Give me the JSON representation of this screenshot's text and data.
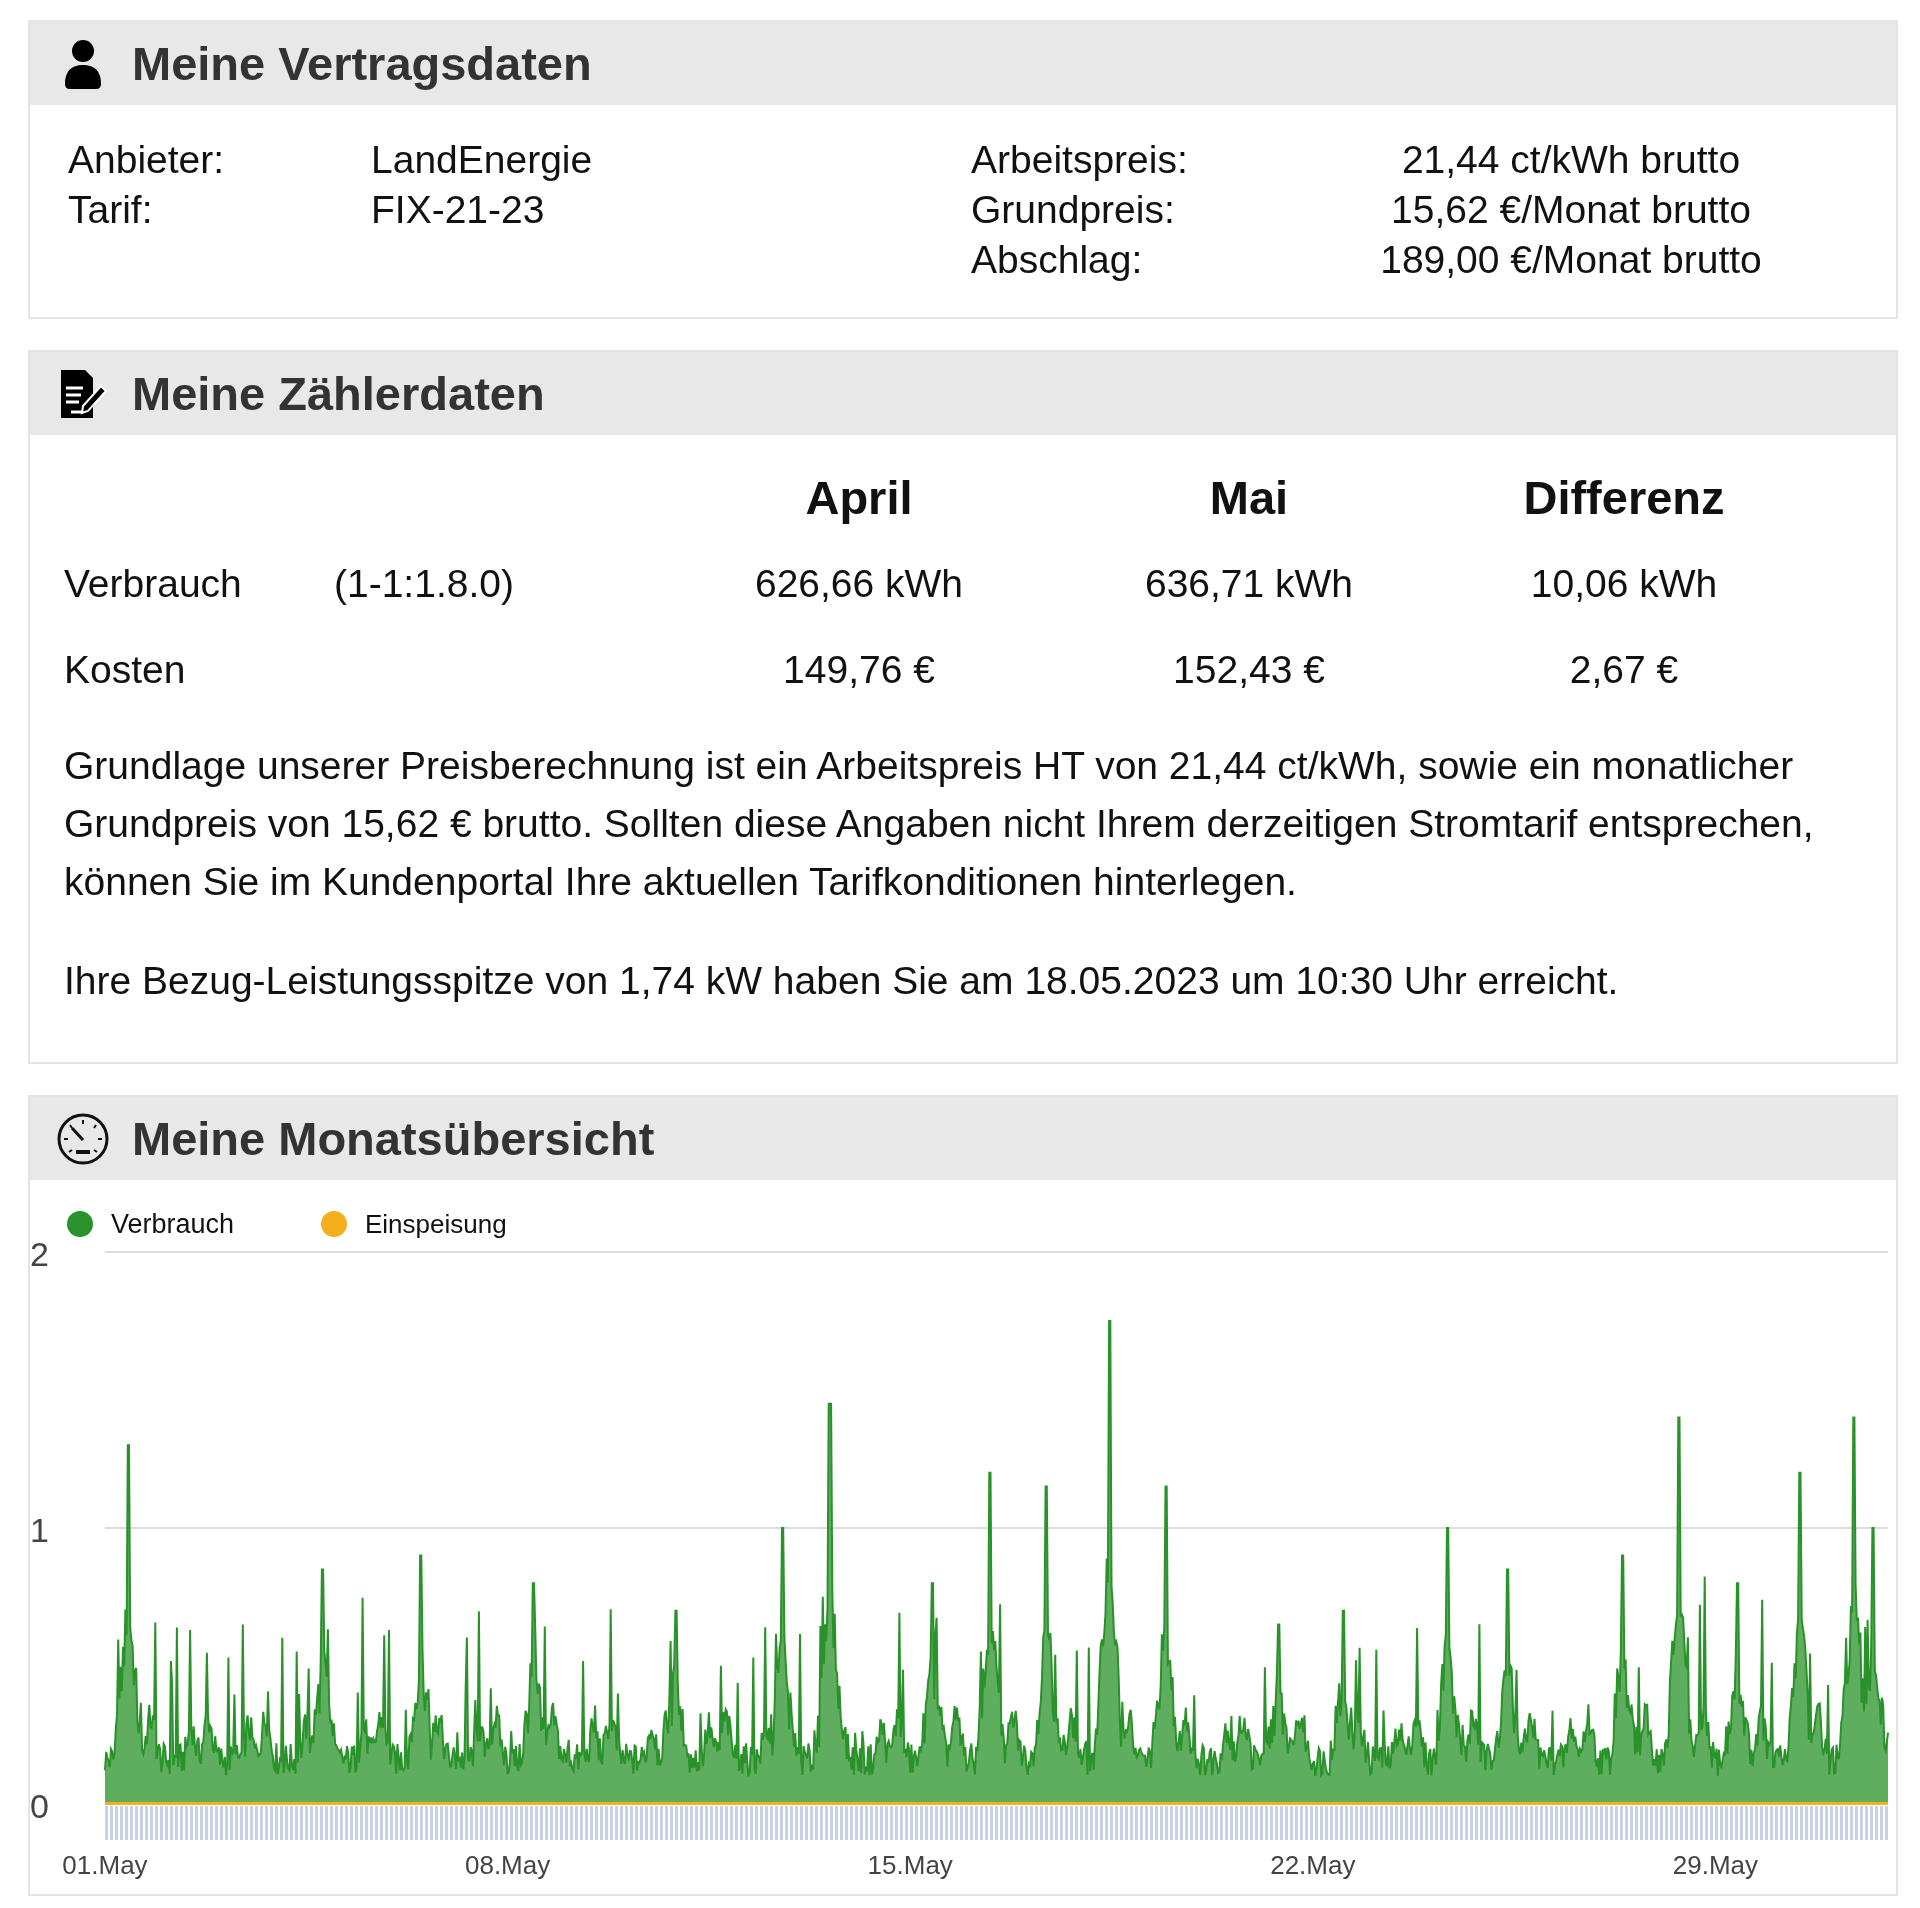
{
  "contract": {
    "title": "Meine Vertragsdaten",
    "left": [
      {
        "label": "Anbieter:",
        "value": "LandEnergie"
      },
      {
        "label": "Tarif:",
        "value": "FIX-21-23"
      }
    ],
    "right": [
      {
        "label": "Arbeitspreis:",
        "value": "21,44 ct/kWh brutto"
      },
      {
        "label": "Grundpreis:",
        "value": "15,62 €/Monat brutto"
      },
      {
        "label": "Abschlag:",
        "value": "189,00 €/Monat brutto"
      }
    ]
  },
  "meter": {
    "title": "Meine Zählerdaten",
    "columns": [
      "April",
      "Mai",
      "Differenz"
    ],
    "rows": [
      {
        "label": "Verbrauch",
        "code": "(1-1:1.8.0)",
        "values": [
          "626,66 kWh",
          "636,71 kWh",
          "10,06 kWh"
        ]
      },
      {
        "label": "Kosten",
        "values": [
          "149,76 €",
          "152,43 €",
          "2,67 €"
        ]
      }
    ],
    "notes": [
      "Grundlage unserer Preisberechnung ist ein Arbeitspreis HT von 21,44 ct/kWh, sowie ein monatlicher Grundpreis von 15,62 € brutto. Sollten diese Angaben nicht Ihrem derzeitigen Stromtarif entsprechen, können Sie im Kundenportal Ihre aktuellen Tarifkonditionen hinterlegen.",
      "Ihre Bezug-Leistungsspitze von 1,74 kW haben Sie am 18.05.2023 um 10:30 Uhr erreicht."
    ]
  },
  "monthly": {
    "title": "Meine Monatsübersicht",
    "legend": [
      {
        "label": "Verbrauch",
        "color": "#2a922a"
      },
      {
        "label": "Einspeisung",
        "color": "#f4b01c"
      }
    ],
    "y_ticks": [
      "2",
      "1",
      "0"
    ],
    "x_labels": [
      "01.May",
      "08.May",
      "15.May",
      "22.May",
      "29.May"
    ]
  }
}
